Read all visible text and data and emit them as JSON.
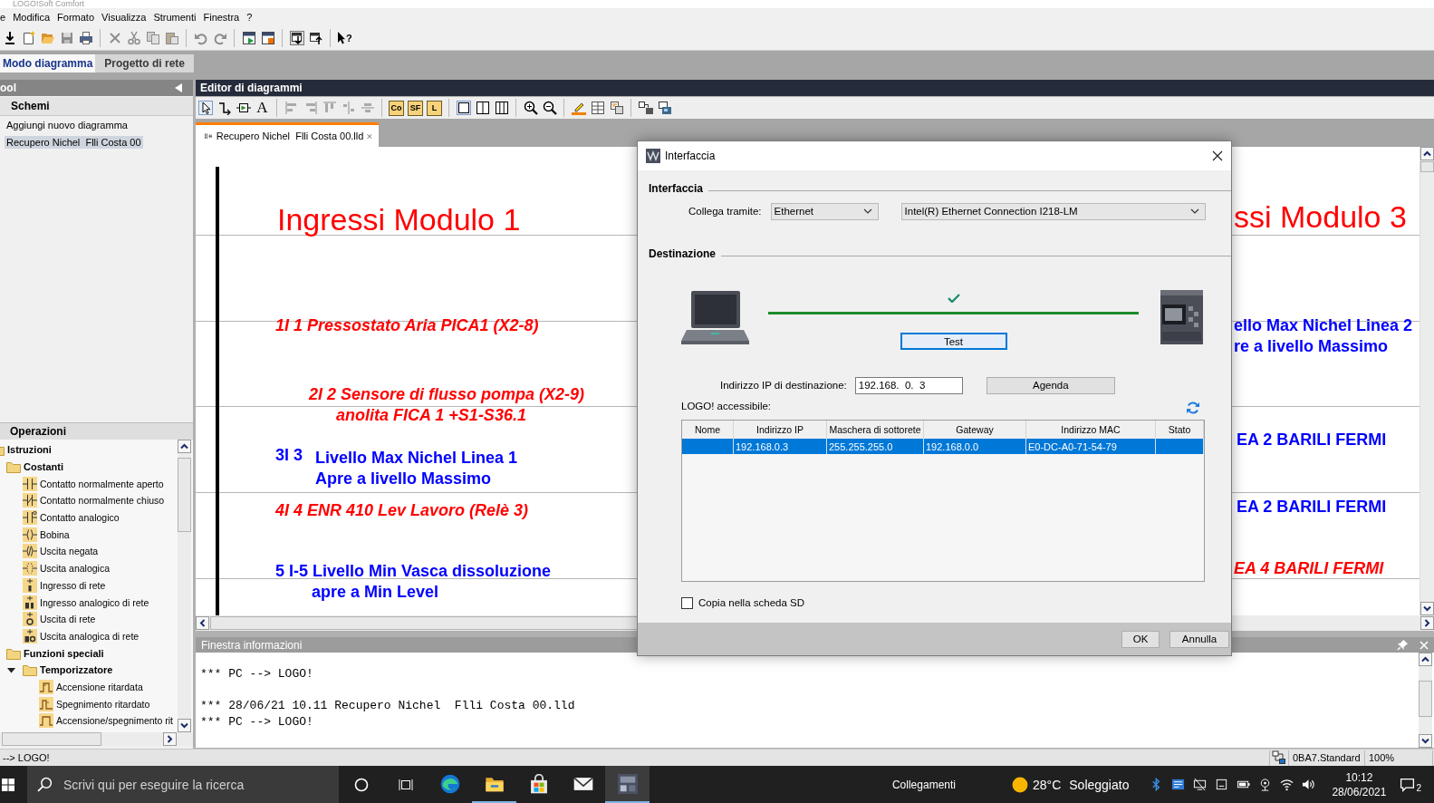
{
  "window": {
    "title": "LOGO!Soft Comfort"
  },
  "menu": [
    "e",
    "Modifica",
    "Formato",
    "Visualizza",
    "Strumenti",
    "Finestra",
    "?"
  ],
  "toolbar": {
    "help_glyph": "?"
  },
  "mode_tabs": [
    {
      "label": "Modo diagramma",
      "selected": true
    },
    {
      "label": "Progetto di rete",
      "selected": false
    }
  ],
  "tool_panel": {
    "title": "ool",
    "section": "Schemi",
    "items": [
      {
        "label": "Aggiungi nuovo diagramma",
        "selected": false
      },
      {
        "label": "Recupero Nichel  Flli Costa 00",
        "selected": true
      }
    ]
  },
  "operations": {
    "title": "Operazioni",
    "tree": [
      {
        "label": "Istruzioni",
        "kind": "folder",
        "children": [
          {
            "label": "Costanti",
            "kind": "folder",
            "children": [
              {
                "label": "Contatto normalmente aperto",
                "kind": "element"
              },
              {
                "label": "Contatto normalmente chiuso",
                "kind": "element"
              },
              {
                "label": "Contatto analogico",
                "kind": "element"
              },
              {
                "label": "Bobina",
                "kind": "element"
              },
              {
                "label": "Uscita negata",
                "kind": "element"
              },
              {
                "label": "Uscita analogica",
                "kind": "element"
              },
              {
                "label": "Ingresso di rete",
                "kind": "element"
              },
              {
                "label": "Ingresso analogico di rete",
                "kind": "element"
              },
              {
                "label": "Uscita di rete",
                "kind": "element"
              },
              {
                "label": "Uscita analogica di rete",
                "kind": "element"
              }
            ]
          },
          {
            "label": "Funzioni speciali",
            "kind": "folder",
            "children": [
              {
                "label": "Temporizzatore",
                "kind": "folder",
                "expanded": true,
                "children": [
                  {
                    "label": "Accensione ritardata",
                    "kind": "element"
                  },
                  {
                    "label": "Spegnimento ritardato",
                    "kind": "element"
                  },
                  {
                    "label": "Accensione/spegnimento rit",
                    "kind": "element"
                  }
                ]
              }
            ]
          }
        ]
      }
    ]
  },
  "editor": {
    "title": "Editor di diagrammi",
    "toolbar": {
      "text_tool": "A",
      "block_tools": [
        "Co",
        "SF",
        "L"
      ]
    },
    "tabs": [
      {
        "label": "Recupero Nichel  Flli Costa 00.lld",
        "selected": true
      }
    ]
  },
  "diagram": {
    "blocks": [
      {
        "kind": "heading",
        "color": "#ff0000",
        "lines": [
          "Ingressi Modulo 1"
        ]
      },
      {
        "kind": "italic",
        "color": "#ff0000",
        "lines": [
          "1I 1 Pressostato Aria PICA1 (X2-8)"
        ]
      },
      {
        "kind": "italic",
        "color": "#ff0000",
        "lines": [
          "2I 2 Sensore di flusso pompa (X2-9)",
          "anolita FICA 1 +S1-S36.1"
        ]
      },
      {
        "kind": "bold",
        "color": "#0000ff",
        "tag": "3I 3",
        "lines": [
          "Livello Max Nichel Linea 1",
          "Apre a livello Massimo"
        ]
      },
      {
        "kind": "italic",
        "color": "#ff0000",
        "lines": [
          "4I 4 ENR 410 Lev Lavoro (Relè 3)"
        ]
      },
      {
        "kind": "bold",
        "color": "#0000ff",
        "lines": [
          "5 I-5 Livello Min Vasca dissoluzione",
          "apre a Min Level"
        ]
      },
      {
        "kind": "heading",
        "color": "#ff0000",
        "lines": [
          "ssi Modulo 3"
        ]
      },
      {
        "kind": "bold",
        "color": "#0000ff",
        "lines": [
          "ello Max Nichel Linea 2",
          "re a livello Massimo"
        ]
      },
      {
        "kind": "bold",
        "color": "#0000ff",
        "lines": [
          "EA 2 BARILI FERMI"
        ]
      },
      {
        "kind": "bold",
        "color": "#0000ff",
        "lines": [
          "EA 2 BARILI FERMI"
        ]
      },
      {
        "kind": "italic",
        "color": "#ff0000",
        "lines": [
          "EA 4 BARILI FERMI"
        ]
      }
    ]
  },
  "dialog": {
    "title": "Interfaccia",
    "interface_heading": "Interfaccia",
    "connect_label": "Collega tramite:",
    "connection": "Ethernet",
    "adapter": "Intel(R) Ethernet Connection I218-LM",
    "destination_heading": "Destinazione",
    "link_ok": true,
    "test_button": "Test",
    "ip_label": "Indirizzo IP di destinazione:",
    "ip_value": "192.168.  0.  3",
    "agenda_button": "Agenda",
    "list_label": "LOGO! accessibile:",
    "table": {
      "columns": [
        "Nome",
        "Indirizzo IP",
        "Maschera di sottorete",
        "Gateway",
        "Indirizzo MAC",
        "Stato"
      ],
      "rows": [
        {
          "selected": true,
          "ip_address": "192.168.0.3",
          "subnet_mask": "255.255.255.0",
          "gateway": "192.168.0.0",
          "mac_address": "E0-DC-A0-71-54-79"
        }
      ]
    },
    "sd_copy": {
      "label": "Copia nella scheda SD",
      "checked": false
    },
    "buttons": [
      "OK",
      "Annulla"
    ]
  },
  "info": {
    "title": "Finestra informazioni",
    "entries": [
      {
        "lines": [
          "*** PC --> LOGO!"
        ]
      },
      {
        "lines": [
          "*** 28/06/21 10.11 Recupero Nichel  Flli Costa 00.lld",
          "*** PC --> LOGO!"
        ]
      }
    ]
  },
  "status_bar": {
    "message": "--> LOGO!",
    "device": "0BA7.Standard",
    "zoom": "100%"
  },
  "taskbar": {
    "search_placeholder": "Scrivi qui per eseguire la ricerca",
    "apps": [
      {
        "open": false,
        "selected": false
      },
      {
        "open": true,
        "selected": false
      },
      {
        "open": false,
        "selected": false
      },
      {
        "open": false,
        "selected": false
      },
      {
        "open": true,
        "selected": true
      }
    ],
    "toolbar_label": "Collegamenti",
    "weather": {
      "temperature": "28°C",
      "condition": "Soleggiato"
    },
    "clock": {
      "time": "10:12",
      "date": "28/06/2021"
    },
    "notifications": "2"
  }
}
